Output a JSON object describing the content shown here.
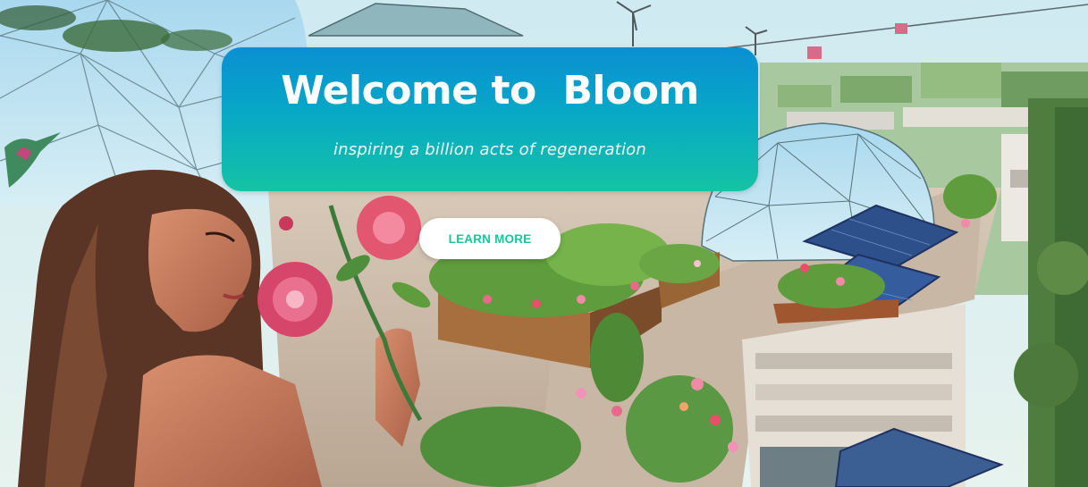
{
  "hero": {
    "title": "Welcome to  Bloom",
    "subtitle": "inspiring a billion acts of regeneration",
    "cta_label": "LEARN MORE"
  },
  "illustration": {
    "description_icons": [
      "geodesic-dome-icon",
      "wind-turbine-icon",
      "solar-panel-icon",
      "hummingbird-icon",
      "flower-icon",
      "planter-box-icon"
    ]
  },
  "colors": {
    "banner_top": "#0a8fd3",
    "banner_bottom": "#14c3a4",
    "cta_text": "#18c79a",
    "cta_bg": "#ffffff"
  }
}
